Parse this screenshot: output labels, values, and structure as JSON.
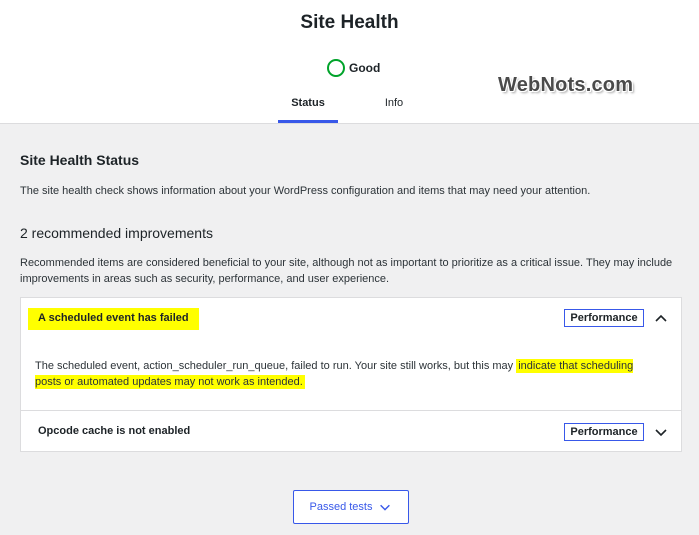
{
  "header": {
    "title": "Site Health",
    "status_label": "Good",
    "status_color": "#00a32a",
    "tabs": [
      {
        "label": "Status",
        "active": true
      },
      {
        "label": "Info",
        "active": false
      }
    ],
    "watermark": "WebNots.com"
  },
  "main": {
    "section_title": "Site Health Status",
    "section_desc": "The site health check shows information about your WordPress configuration and items that may need your attention.",
    "improvements_title": "2 recommended improvements",
    "improvements_desc": "Recommended items are considered beneficial to your site, although not as important to prioritize as a critical issue. They may include improvements in areas such as security, performance, and user experience.",
    "issues": [
      {
        "title": "A scheduled event has failed",
        "badge": "Performance",
        "expanded": true,
        "body_plain": "The scheduled event, action_scheduler_run_queue, failed to run. Your site still works, but this may ",
        "body_highlight": "indicate that scheduling posts or automated updates may not work as intended.",
        "chevron_icon": "chevron-up-icon"
      },
      {
        "title": "Opcode cache is not enabled",
        "badge": "Performance",
        "expanded": false,
        "chevron_icon": "chevron-down-icon"
      }
    ],
    "passed_tests_label": "Passed tests"
  },
  "colors": {
    "accent": "#3858e9",
    "highlight": "#ffff00",
    "background": "#f0f0f1"
  }
}
